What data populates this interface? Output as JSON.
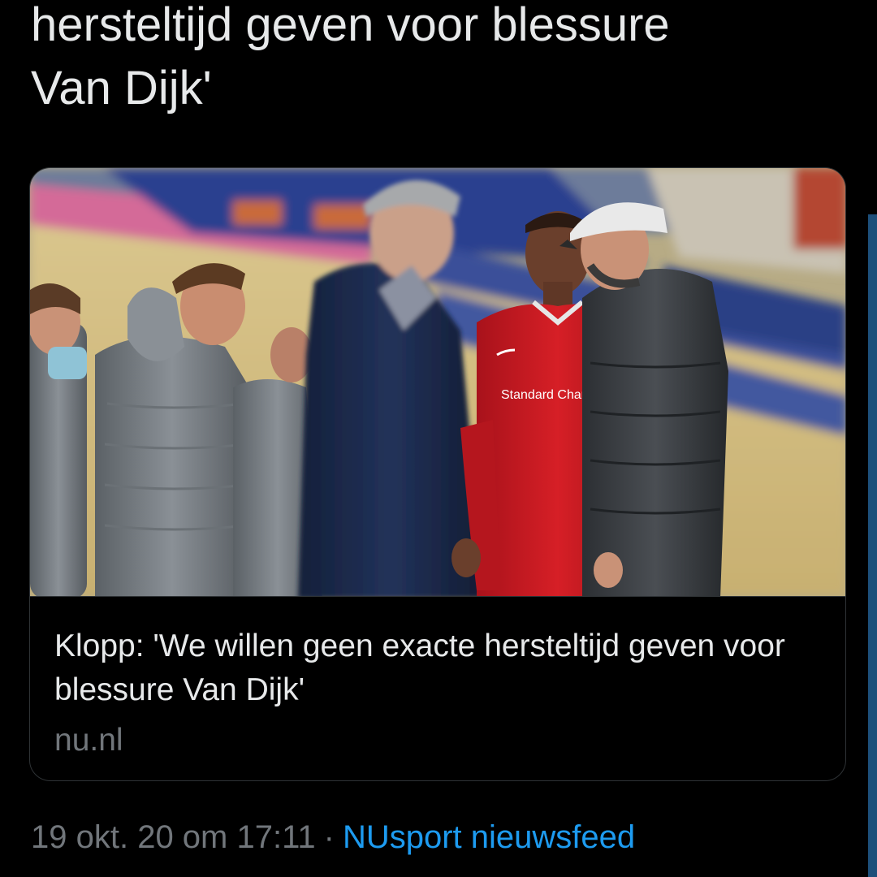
{
  "tweet": {
    "text": "hersteltijd geven voor blessure\nVan Dijk'"
  },
  "card": {
    "image_alt": "Klopp talking to Van Dijk on the sideline",
    "title": "Klopp: 'We willen geen exacte hersteltijd geven voor blessure Van Dijk'",
    "domain": "nu.nl",
    "shirt_sponsor": "Standard Chartered"
  },
  "meta": {
    "timestamp": "19 okt. 20 om 17:11",
    "separator": "·",
    "source": "NUsport nieuwsfeed"
  },
  "colors": {
    "background": "#000000",
    "text": "#e7e9ea",
    "muted": "#71767b",
    "link": "#1d9bf0",
    "border": "#2f3336"
  }
}
